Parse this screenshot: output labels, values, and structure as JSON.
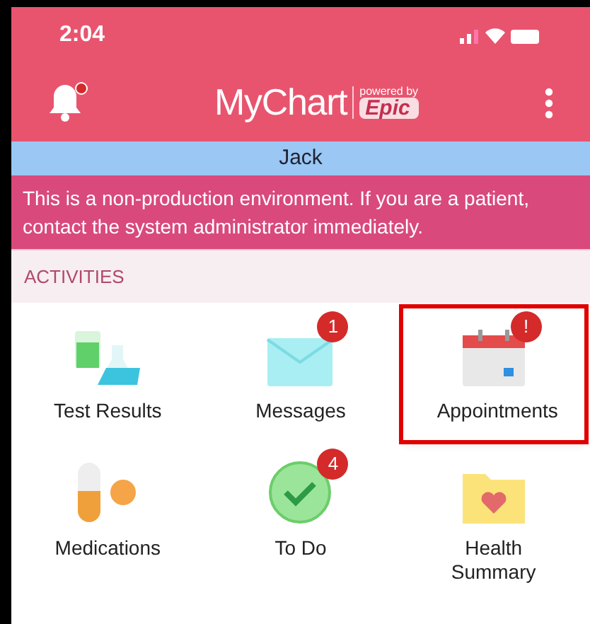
{
  "status_bar": {
    "time": "2:04"
  },
  "header": {
    "logo": "MyChart",
    "powered_by": "powered by",
    "brand": "Epic",
    "bell_alert": true
  },
  "patient_bar": {
    "name": "Jack"
  },
  "banner": {
    "text": "This is a non-production environment. If you are a patient, contact the system administrator immediately."
  },
  "section": {
    "title": "ACTIVITIES"
  },
  "activities": [
    {
      "label": "Test Results",
      "kind": "lab",
      "highlighted": false
    },
    {
      "label": "Messages",
      "kind": "envelope",
      "badge": "1",
      "highlighted": false
    },
    {
      "label": "Appointments",
      "kind": "calendar",
      "badge": "!",
      "highlighted": true
    },
    {
      "label": "Medications",
      "kind": "pill",
      "highlighted": false
    },
    {
      "label": "To Do",
      "kind": "check",
      "badge": "4",
      "highlighted": false
    },
    {
      "label": "Health Summary",
      "kind": "folder",
      "highlighted": false
    }
  ]
}
